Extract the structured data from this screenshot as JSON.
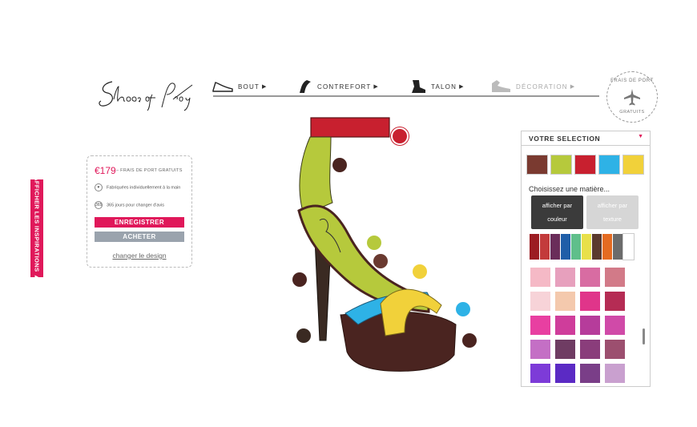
{
  "side_tab": {
    "label": "AFFICHER LES INSPIRATIONS ▲"
  },
  "logo": {
    "alt": "Shoes of Prey"
  },
  "nav": [
    {
      "label": "BOUT",
      "icon": "toe-shoe-icon"
    },
    {
      "label": "CONTREFORT",
      "icon": "heel-counter-icon"
    },
    {
      "label": "TALON",
      "icon": "heel-icon"
    },
    {
      "label": "DÉCORATION",
      "icon": "decoration-icon"
    }
  ],
  "shipping_badge": {
    "top": "FRAIS DE PORT",
    "bottom": "GRATUITS",
    "icon": "airplane-icon"
  },
  "price_box": {
    "price": "€179",
    "price_note": "– FRAIS DE PORT GRATUITS",
    "feature1": "Fabriquées individuellement à la main",
    "feature2": "365 jours pour changer d'avis",
    "save_label": "ENREGISTRER",
    "buy_label": "ACHETER",
    "change_label": "changer le design"
  },
  "panel": {
    "title": "VOTRE SELECTION",
    "choose_label": "Choisissez une matière...",
    "btn_color_line1": "afficher par",
    "btn_color_line2": "couleur",
    "btn_texture_line1": "afficher par",
    "btn_texture_line2": "texture",
    "selection_colors": [
      "#7a3a30",
      "#b6c93c",
      "#c8202f",
      "#2eb2e6",
      "#f1d13a"
    ],
    "strip_colors": [
      "#9c1c22",
      "#c33b3b",
      "#6a2d5a",
      "#1f5ea8",
      "#5fbf8b",
      "#e8e04a",
      "#5b3a2e",
      "#e46b21",
      "#6b6b6b",
      "#ffffff"
    ],
    "grid_colors": [
      "#f5b9c6",
      "#e7a0bd",
      "#d86ca2",
      "#d27a88",
      "#f7d3d8",
      "#f4c9ad",
      "#e0358a",
      "#b52c54",
      "#e83fa1",
      "#cf3d9b",
      "#b63c9b",
      "#d04aa8",
      "#c46fc5",
      "#6f3c63",
      "#8a3d7b",
      "#9c4f6f",
      "#7d3bd8",
      "#5b2ac4",
      "#7a3e88",
      "#c9a0cf"
    ]
  },
  "colors": {
    "accent": "#e0185a",
    "strap": "#c8202f",
    "heel_counter": "#b6c93c",
    "front_strap_blue": "#2eb2e6",
    "front_strap_yellow": "#f1d13a",
    "sole": "#4a2420"
  }
}
